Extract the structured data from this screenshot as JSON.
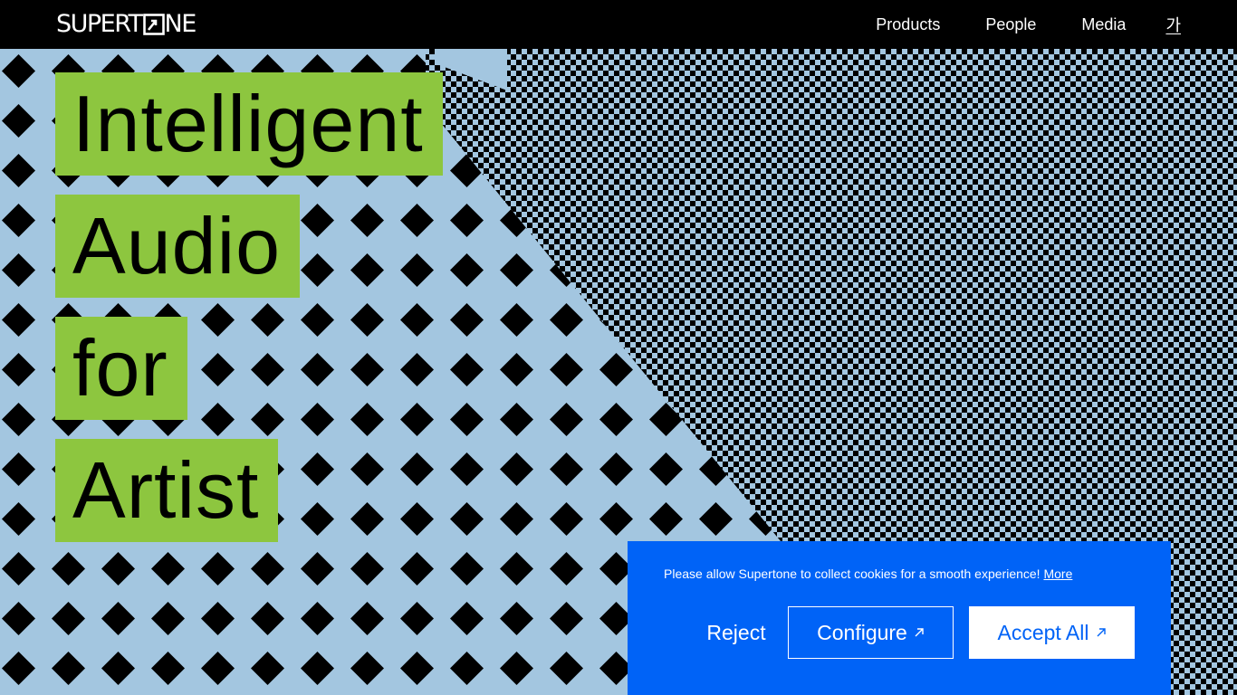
{
  "header": {
    "logo_text_before": "SUPERT",
    "logo_text_after": "NE",
    "nav": [
      "Products",
      "People",
      "Media"
    ],
    "lang_toggle": "가"
  },
  "hero": {
    "headline": [
      "Intelligent",
      "Audio",
      "for",
      "Artist"
    ],
    "highlight_color": "#8dc63f",
    "background_color": "#a3c6e0"
  },
  "cookie_banner": {
    "message": "Please allow Supertone to collect cookies for a smooth experience!",
    "more_link": "More",
    "reject_label": "Reject",
    "configure_label": "Configure",
    "accept_label": "Accept All",
    "background_color": "#0063f7",
    "arrow_icon": "arrow-up-right-icon"
  }
}
